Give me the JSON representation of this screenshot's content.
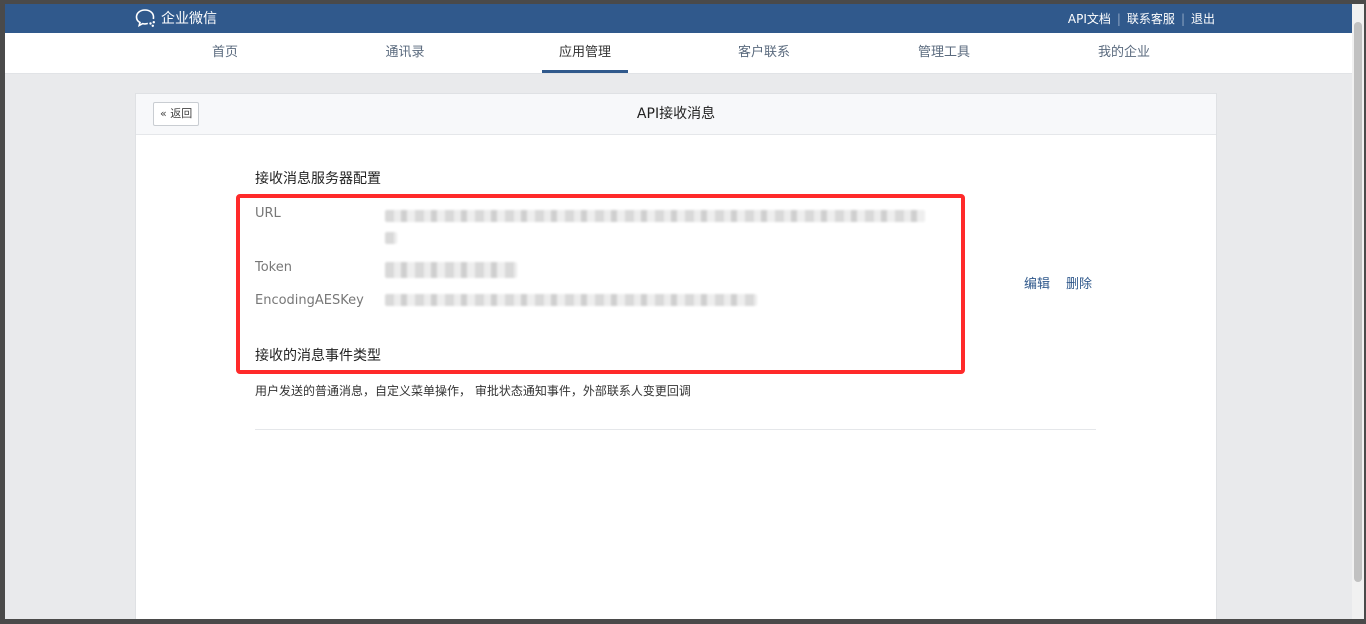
{
  "app": {
    "brand": "企业微信",
    "accent_color": "#30598c"
  },
  "top_links": [
    "API文档",
    "联系客服",
    "退出"
  ],
  "nav": {
    "items": [
      {
        "label": "首页"
      },
      {
        "label": "通讯录"
      },
      {
        "label": "应用管理",
        "active": true
      },
      {
        "label": "客户联系"
      },
      {
        "label": "管理工具"
      },
      {
        "label": "我的企业"
      }
    ]
  },
  "page": {
    "back_label": "返回",
    "title": "API接收消息",
    "server_section_title": "接收消息服务器配置",
    "fields": {
      "url_label": "URL",
      "token_label": "Token",
      "aes_label": "EncodingAESKey"
    },
    "actions": {
      "edit": "编辑",
      "delete": "删除"
    },
    "events_section_title": "接收的消息事件类型",
    "events_description": "用户发送的普通消息，自定义菜单操作， 审批状态通知事件，外部联系人变更回调"
  },
  "icons": [
    "chat-bubble-logo-icon",
    "double-chevron-left-icon"
  ]
}
